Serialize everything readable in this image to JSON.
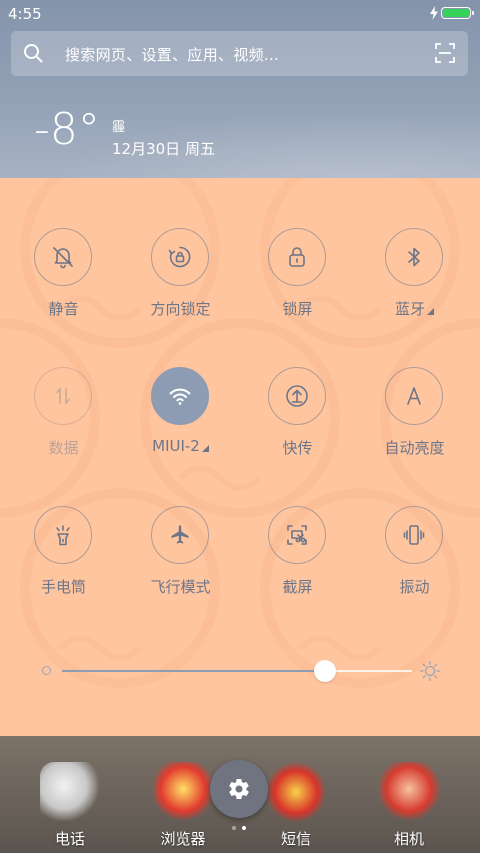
{
  "status_bar": {
    "time": "4:55",
    "battery_color": "#36d15b"
  },
  "search": {
    "placeholder": "搜索网页、设置、应用、视频..."
  },
  "weather": {
    "temperature": "-8°",
    "condition": "霾",
    "date": "12月30日 周五"
  },
  "toggles": [
    {
      "label": "静音",
      "icon": "bell-muted-icon",
      "state": "off"
    },
    {
      "label": "方向锁定",
      "icon": "rotation-lock-icon",
      "state": "off"
    },
    {
      "label": "锁屏",
      "icon": "lock-icon",
      "state": "off"
    },
    {
      "label": "蓝牙",
      "icon": "bluetooth-icon",
      "state": "off",
      "has_menu": true
    },
    {
      "label": "数据",
      "icon": "mobile-data-icon",
      "state": "disabled"
    },
    {
      "label": "MIUI-2",
      "icon": "wifi-icon",
      "state": "on",
      "has_menu": true
    },
    {
      "label": "快传",
      "icon": "quick-transfer-icon",
      "state": "off"
    },
    {
      "label": "自动亮度",
      "icon": "auto-brightness-icon",
      "state": "off"
    },
    {
      "label": "手电筒",
      "icon": "flashlight-icon",
      "state": "off"
    },
    {
      "label": "飞行模式",
      "icon": "airplane-icon",
      "state": "off"
    },
    {
      "label": "截屏",
      "icon": "screenshot-icon",
      "state": "off"
    },
    {
      "label": "振动",
      "icon": "vibrate-icon",
      "state": "off"
    }
  ],
  "brightness": {
    "level": 0.75
  },
  "dock": [
    {
      "label": "电话",
      "icon": "phone-app-icon"
    },
    {
      "label": "浏览器",
      "icon": "browser-app-icon"
    },
    {
      "label": "短信",
      "icon": "messages-app-icon"
    },
    {
      "label": "相机",
      "icon": "camera-app-icon"
    }
  ],
  "colors": {
    "panel_bg": "#ffc59f",
    "active_toggle": "#8d9cb3",
    "icon_stroke": "#6d7588"
  },
  "page_indicator": {
    "count": 2,
    "active": 1
  }
}
